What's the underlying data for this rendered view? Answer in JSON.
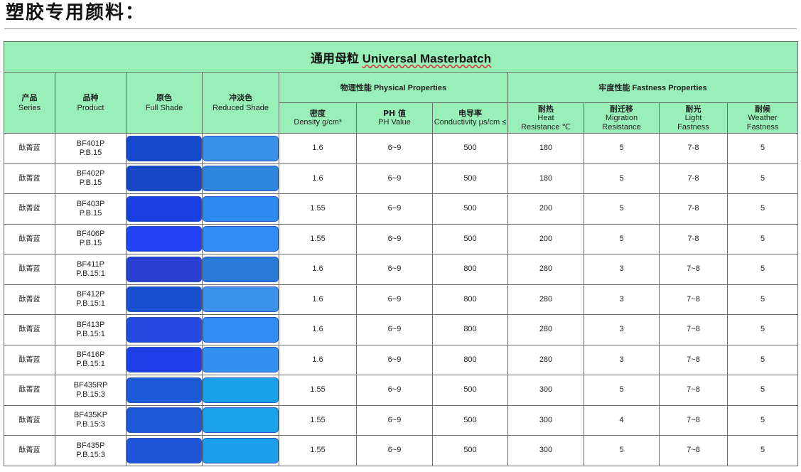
{
  "page_heading": "塑胶专用颜料：",
  "table": {
    "title_zh": "通用母粒",
    "title_en": "Universal Masterbatch",
    "headers": {
      "series": {
        "zh": "产品",
        "en": "Series"
      },
      "product": {
        "zh": "品种",
        "en": "Product"
      },
      "full_shade": {
        "zh": "原色",
        "en": "Full Shade"
      },
      "reduced_shade": {
        "zh": "冲淡色",
        "en": "Reduced Shade"
      },
      "physical": "物理性能 Physical Properties",
      "fastness": "牢度性能 Fastness Properties",
      "density": {
        "zh": "密度",
        "en": "Density g/cm³"
      },
      "ph": {
        "zh": "PH 值",
        "en": "PH Value"
      },
      "conductivity": {
        "zh": "电导率",
        "en": "Conductivity μs/cm ≤"
      },
      "heat": {
        "zh": "耐热",
        "en1": "Heat",
        "en2": "Resistance ℃"
      },
      "migration": {
        "zh": "耐迁移",
        "en1": "Migration",
        "en2": "Resistance"
      },
      "light": {
        "zh": "耐光",
        "en1": "Light",
        "en2": "Fastness"
      },
      "weather": {
        "zh": "耐候",
        "en1": "Weather",
        "en2": "Fastness"
      }
    },
    "rows": [
      {
        "series": "酞菁蓝",
        "code": "BF401P",
        "ci": "P.B.15",
        "full": "#1548cc",
        "reduced": "#3a8fe6",
        "density": "1.6",
        "ph": "6~9",
        "cond": "500",
        "heat": "180",
        "migration": "5",
        "light": "7-8",
        "weather": "5"
      },
      {
        "series": "酞菁蓝",
        "code": "BF402P",
        "ci": "P.B.15",
        "full": "#1645c6",
        "reduced": "#2f84dc",
        "density": "1.6",
        "ph": "6~9",
        "cond": "500",
        "heat": "180",
        "migration": "5",
        "light": "7-8",
        "weather": "5"
      },
      {
        "series": "酞菁蓝",
        "code": "BF403P",
        "ci": "P.B.15",
        "full": "#1a3fe0",
        "reduced": "#2d8bf0",
        "density": "1.55",
        "ph": "6~9",
        "cond": "500",
        "heat": "200",
        "migration": "5",
        "light": "7-8",
        "weather": "5"
      },
      {
        "series": "酞菁蓝",
        "code": "BF406P",
        "ci": "P.B.15",
        "full": "#2241f5",
        "reduced": "#2f8cf6",
        "density": "1.55",
        "ph": "6~9",
        "cond": "500",
        "heat": "200",
        "migration": "5",
        "light": "7-8",
        "weather": "5"
      },
      {
        "series": "酞菁蓝",
        "code": "BF411P",
        "ci": "P.B.15:1",
        "full": "#2a3fd2",
        "reduced": "#2a7bd9",
        "density": "1.6",
        "ph": "6~9",
        "cond": "800",
        "heat": "280",
        "migration": "3",
        "light": "7~8",
        "weather": "5"
      },
      {
        "series": "酞菁蓝",
        "code": "BF412P",
        "ci": "P.B.15:1",
        "full": "#1850cf",
        "reduced": "#3c92e8",
        "density": "1.6",
        "ph": "6~9",
        "cond": "800",
        "heat": "280",
        "migration": "3",
        "light": "7~8",
        "weather": "5"
      },
      {
        "series": "酞菁蓝",
        "code": "BF413P",
        "ci": "P.B.15:1",
        "full": "#2548e0",
        "reduced": "#2f8df2",
        "density": "1.6",
        "ph": "6~9",
        "cond": "800",
        "heat": "280",
        "migration": "3",
        "light": "7~8",
        "weather": "5"
      },
      {
        "series": "酞菁蓝",
        "code": "BF416P",
        "ci": "P.B.15:1",
        "full": "#1f3ee8",
        "reduced": "#3290f0",
        "density": "1.6",
        "ph": "6~9",
        "cond": "800",
        "heat": "280",
        "migration": "3",
        "light": "7~8",
        "weather": "5"
      },
      {
        "series": "酞菁蓝",
        "code": "BF435RP",
        "ci": "P.B.15:3",
        "full": "#1c5ad8",
        "reduced": "#1aa0e6",
        "density": "1.55",
        "ph": "6~9",
        "cond": "500",
        "heat": "300",
        "migration": "5",
        "light": "7~8",
        "weather": "5"
      },
      {
        "series": "酞菁蓝",
        "code": "BF435KP",
        "ci": "P.B.15:3",
        "full": "#1d58d6",
        "reduced": "#1ba2e8",
        "density": "1.55",
        "ph": "6~9",
        "cond": "500",
        "heat": "300",
        "migration": "4",
        "light": "7~8",
        "weather": "5"
      },
      {
        "series": "酞菁蓝",
        "code": "BF435P",
        "ci": "P.B.15:3",
        "full": "#1f55d8",
        "reduced": "#1c9ee8",
        "density": "1.55",
        "ph": "6~9",
        "cond": "500",
        "heat": "300",
        "migration": "5",
        "light": "7~8",
        "weather": "5"
      }
    ]
  }
}
